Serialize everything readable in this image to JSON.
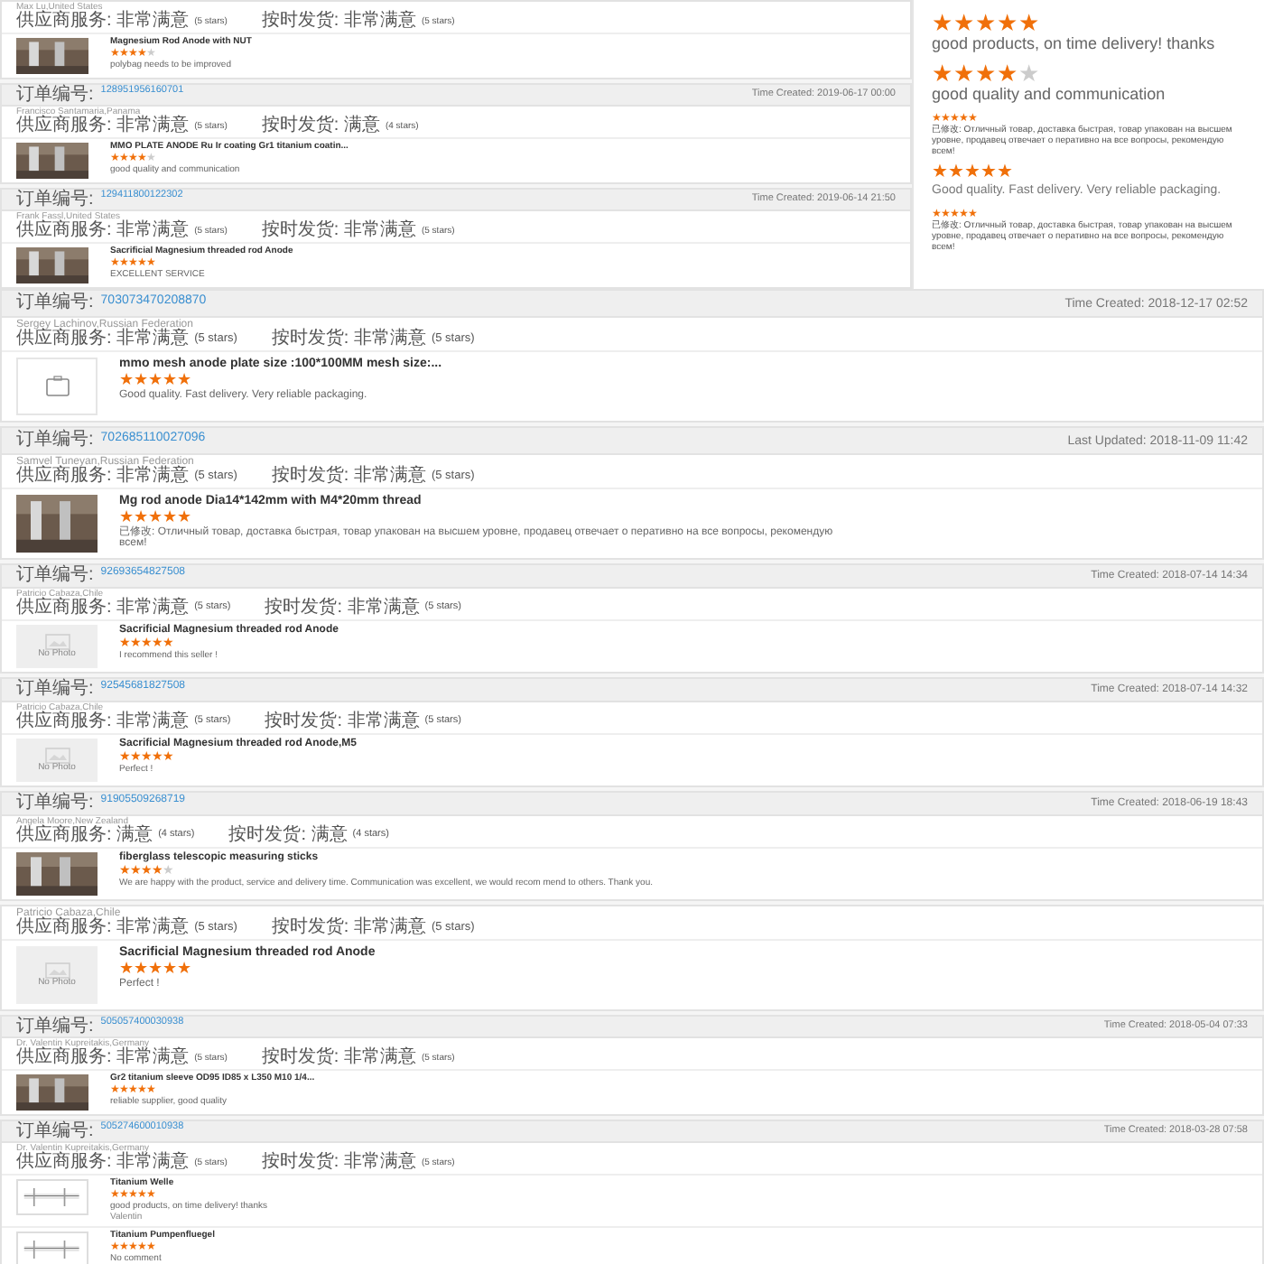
{
  "top_orders": [
    {
      "kind": "tiny",
      "buyer": "Max Lu,United States",
      "ratings": [
        "供应商服务: 非常满意",
        "(5 stars)",
        "按时发货: 非常满意",
        "(5 stars)"
      ],
      "items": [
        {
          "title": "Magnesium Rod Anode with NUT",
          "stars": 4,
          "comment": "polybag needs to be improved"
        }
      ]
    },
    {
      "kind": "tiny",
      "order_label": "订单编号:",
      "order": "128951956160701",
      "time": "Time Created: 2019-06-17 00:00",
      "buyer": "Francisco Santamaria,Panama",
      "ratings": [
        "供应商服务: 非常满意",
        "(5 stars)",
        "按时发货: 满意",
        "(4 stars)"
      ],
      "items": [
        {
          "title": "MMO PLATE ANODE Ru Ir coating Gr1 titanium coatin...",
          "stars": 4,
          "comment": "good quality and communication"
        }
      ]
    },
    {
      "kind": "tiny",
      "order_label": "订单编号:",
      "order": "129411800122302",
      "time": "Time Created: 2019-06-14 21:50",
      "buyer": "Frank Fassl,United States",
      "ratings": [
        "供应商服务: 非常满意",
        "(5 stars)",
        "按时发货: 非常满意",
        "(5 stars)"
      ],
      "items": [
        {
          "title": "Sacrificial Magnesium threaded rod Anode",
          "stars": 5,
          "comment": "EXCELLENT SERVICE"
        }
      ]
    }
  ],
  "side_reviews": [
    {
      "kind": "large",
      "stars": 5,
      "comment": "good products, on time delivery! thanks"
    },
    {
      "kind": "large",
      "stars": 4,
      "comment": "good quality and communication"
    },
    {
      "kind": "small",
      "stars": 5,
      "comment": "已修改: Отличный товар, доставка быстрая, товар упакован на высшем уровне, продавец отвечает о перативно на все вопросы, рекомендую всем!"
    },
    {
      "kind": "medium",
      "stars": 5,
      "comment": "Good quality. Fast delivery. Very reliable packaging."
    },
    {
      "kind": "small",
      "stars": 5,
      "comment": "已修改: Отличный товар, доставка быстрая, товар упакован на высшем уровне, продавец отвечает о перативно на все вопросы, рекомендую всем!"
    }
  ],
  "orders": [
    {
      "kind": "large",
      "order_label": "订单编号:",
      "order": "703073470208870",
      "time": "Time Created: 2018-12-17 02:52",
      "buyer": "Sergey Lachinov,Russian Federation",
      "ratings": [
        "供应商服务: 非常满意",
        "(5 stars)",
        "按时发货: 非常满意",
        "(5 stars)"
      ],
      "items": [
        {
          "title": "mmo mesh anode plate size :100*100MM mesh size:...",
          "stars": 5,
          "comment": "Good quality. Fast delivery. Very reliable packaging.",
          "image": {
            "kind": "placeholder"
          }
        }
      ]
    },
    {
      "kind": "large",
      "order_label": "订单编号:",
      "order": "702685110027096",
      "time": "Last Updated: 2018-11-09 11:42",
      "buyer": "Samvel Tuneyan,Russian Federation",
      "ratings": [
        "供应商服务: 非常满意",
        "(5 stars)",
        "按时发货: 非常满意",
        "(5 stars)"
      ],
      "items": [
        {
          "title": "Mg rod anode Dia14*142mm with M4*20mm thread",
          "stars": 5,
          "comment": "已修改: Отличный товар, доставка быстрая, товар упакован на высшем уровне, продавец отвечает о перативно на все вопросы, рекомендую всем!"
        }
      ]
    },
    {
      "kind": "small",
      "order_label": "订单编号:",
      "order": "92693654827508",
      "time": "Time Created: 2018-07-14 14:34",
      "buyer": "Patricio Cabaza,Chile",
      "ratings": [
        "供应商服务: 非常满意",
        "(5 stars)",
        "按时发货: 非常满意",
        "(5 stars)"
      ],
      "items": [
        {
          "title": "Sacrificial Magnesium threaded rod Anode",
          "stars": 5,
          "comment": "I recommend this seller !",
          "image": {
            "kind": "no-photo",
            "label": "No Photo"
          }
        }
      ]
    },
    {
      "kind": "small",
      "order_label": "订单编号:",
      "order": "92545681827508",
      "time": "Time Created: 2018-07-14 14:32",
      "buyer": "Patricio Cabaza,Chile",
      "ratings": [
        "供应商服务: 非常满意",
        "(5 stars)",
        "按时发货: 非常满意",
        "(5 stars)"
      ],
      "items": [
        {
          "title": "Sacrificial Magnesium threaded rod Anode,M5",
          "stars": 5,
          "comment": "Perfect !",
          "image": {
            "kind": "no-photo",
            "label": "No Photo"
          }
        }
      ]
    },
    {
      "kind": "small",
      "order_label": "订单编号:",
      "order": "91905509268719",
      "time": "Time Created: 2018-06-19 18:43",
      "buyer": "Angela Moore,New Zealand",
      "ratings": [
        "供应商服务: 满意",
        "(4 stars)",
        "按时发货: 满意",
        "(4 stars)"
      ],
      "items": [
        {
          "title": "fiberglass telescopic measuring sticks",
          "stars": 4,
          "comment": "We are happy with the product, service and delivery time.  Communication was excellent, we would recom mend to others. Thank you."
        }
      ]
    },
    {
      "kind": "large",
      "buyer": "Patricio Cabaza,Chile",
      "ratings": [
        "供应商服务: 非常满意",
        "(5 stars)",
        "按时发货: 非常满意",
        "(5 stars)"
      ],
      "items": [
        {
          "title": "Sacrificial Magnesium threaded rod Anode",
          "stars": 5,
          "comment": "Perfect !",
          "image": {
            "kind": "no-photo",
            "label": "No Photo"
          }
        }
      ]
    },
    {
      "kind": "tiny",
      "order_label": "订单编号:",
      "order": "505057400030938",
      "time": "Time Created: 2018-05-04 07:33",
      "buyer": "Dr. Valentin Kupreitakis,Germany",
      "ratings": [
        "供应商服务: 非常满意",
        "(5 stars)",
        "按时发货: 非常满意",
        "(5 stars)"
      ],
      "items": [
        {
          "title": "Gr2 titanium sleeve OD95 ID85 x L350 M10 1/4...",
          "stars": 5,
          "comment": "reliable supplier, good quality"
        }
      ]
    },
    {
      "kind": "tiny",
      "order_label": "订单编号:",
      "order": "505274600010938",
      "time": "Time Created: 2018-03-28 07:58",
      "buyer": "Dr. Valentin Kupreitakis,Germany",
      "ratings": [
        "供应商服务: 非常满意",
        "(5 stars)",
        "按时发货: 非常满意",
        "(5 stars)"
      ],
      "items": [
        {
          "title": "Titanium Welle",
          "stars": 5,
          "comment": "good products, on time delivery! thanks",
          "signature": "Valentin",
          "image": {
            "kind": "drawing"
          }
        },
        {
          "title": "Titanium Pumpenfluegel",
          "stars": 5,
          "comment": "No comment",
          "image": {
            "kind": "drawing"
          }
        }
      ]
    }
  ]
}
